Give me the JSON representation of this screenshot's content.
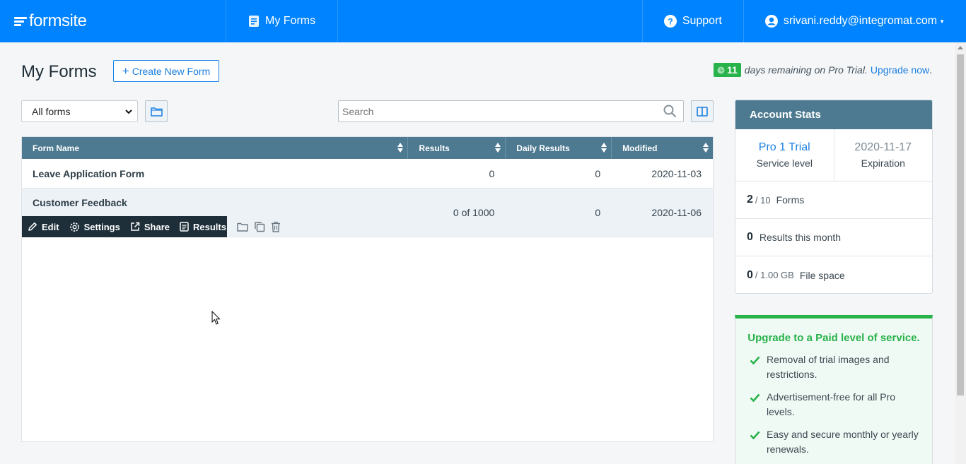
{
  "header": {
    "logo_text": "formsite",
    "nav_my_forms": "My Forms",
    "nav_support": "Support",
    "user_email": "srivani.reddy@integromat.com"
  },
  "page": {
    "title": "My Forms",
    "create_label": "Create New Form",
    "trial_days": "11",
    "trial_text": "days remaining on Pro Trial.",
    "upgrade_link": "Upgrade now",
    "trial_period": "."
  },
  "filters": {
    "selected": "All forms",
    "search_placeholder": "Search"
  },
  "table": {
    "columns": [
      "Form Name",
      "Results",
      "Daily Results",
      "Modified"
    ],
    "rows": [
      {
        "name": "Leave Application Form",
        "results": "0",
        "daily": "0",
        "modified": "2020-11-03"
      },
      {
        "name": "Customer Feedback",
        "results": "0 of 1000",
        "daily": "0",
        "modified": "2020-11-06"
      }
    ],
    "actions": {
      "edit": "Edit",
      "settings": "Settings",
      "share": "Share",
      "results": "Results"
    }
  },
  "stats": {
    "title": "Account Stats",
    "level": "Pro 1 Trial",
    "level_label": "Service level",
    "expiration": "2020-11-17",
    "expiration_label": "Expiration",
    "forms_used": "2",
    "forms_total": "/ 10",
    "forms_label": "Forms",
    "results_count": "0",
    "results_label": "Results this month",
    "space_used": "0",
    "space_total": "/ 1.00 GB",
    "space_label": "File space"
  },
  "upgrade": {
    "title": "Upgrade to a Paid level of service.",
    "items": [
      "Removal of trial images and restrictions.",
      "Advertisement-free for all Pro levels.",
      "Easy and secure monthly or yearly renewals."
    ]
  },
  "colors": {
    "brand": "#0083ff",
    "table_header": "#4d7a90",
    "success": "#27b24a",
    "link": "#1b7fe0"
  }
}
